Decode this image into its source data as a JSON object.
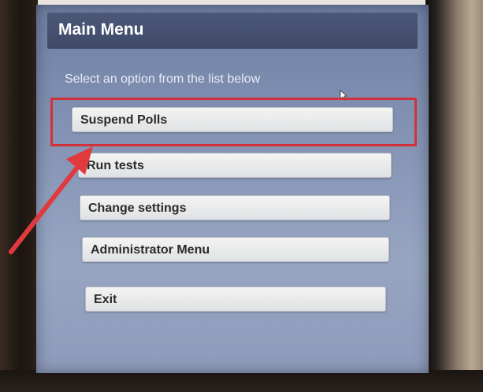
{
  "screen": {
    "title": "Main Menu",
    "subtitle": "Select an option from the list below"
  },
  "menu": {
    "items": [
      {
        "label": "Suspend Polls"
      },
      {
        "label": "Run tests"
      },
      {
        "label": "Change settings"
      },
      {
        "label": "Administrator Menu"
      },
      {
        "label": "Exit"
      }
    ]
  },
  "annotation": {
    "highlight_color": "#d1323a",
    "arrow_color": "#e03a3e"
  }
}
